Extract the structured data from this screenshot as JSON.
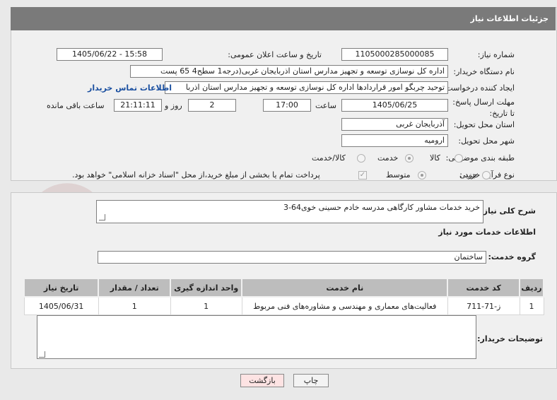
{
  "header": {
    "title": "جزئیات اطلاعات نیاز"
  },
  "watermark": {
    "text": "AriaTender.net"
  },
  "fields": {
    "need_number_label": "شماره نیاز:",
    "need_number": "1105000285000085",
    "announce_label": "تاریخ و ساعت اعلان عمومی:",
    "announce_value": "1405/06/22 - 15:58",
    "buyer_org_label": "نام دستگاه خریدار:",
    "buyer_org": "اداره کل نوسازی   توسعه و تجهیز مدارس استان اذربایجان غربی(درجه1  سطح4  65 پست",
    "creator_label": "ایجاد کننده درخواست:",
    "creator": "توحید چربگو امور قراردادها اداره کل نوسازی   توسعه و تجهیز مدارس استان اذربا",
    "buyer_contact_link": "اطلاعات تماس خریدار",
    "deadline_label": "مهلت ارسال پاسخ: تا تاریخ:",
    "deadline_date": "1405/06/25",
    "time_label": "ساعت",
    "deadline_time": "17:00",
    "days_value": "2",
    "days_label": "روز و",
    "remaining_time": "21:11:11",
    "remaining_label": "ساعت باقی مانده",
    "province_label": "استان محل تحویل:",
    "province": "آذربایجان غربی",
    "city_label": "شهر محل تحویل:",
    "city": "ارومیه",
    "category_label": "طبقه بندی موضوعی:",
    "category_options": [
      "کالا",
      "خدمت",
      "کالا/خدمت"
    ],
    "category_selected": "خدمت",
    "purchase_type_label": "نوع فرآیند خرید :",
    "purchase_options": [
      "جزیی",
      "متوسط"
    ],
    "purchase_selected": "متوسط",
    "payment_note": "پرداخت تمام یا بخشی از مبلغ خرید،از محل \"اسناد خزانه اسلامی\" خواهد بود."
  },
  "summary": {
    "label": "شرح کلی نیاز:",
    "value": "خرید خدمات مشاور کارگاهی مدرسه خادم حسینی خوی64-3",
    "services_heading": "اطلاعات خدمات مورد نیاز",
    "group_label": "گروه خدمت:",
    "group_value": "ساختمان"
  },
  "table": {
    "headers": [
      "ردیف",
      "کد خدمت",
      "نام خدمت",
      "واحد اندازه گیری",
      "تعداد / مقدار",
      "تاریخ نیاز"
    ],
    "rows": [
      [
        "1",
        "ز-71-711",
        "فعالیت‌های معماری و مهندسی و مشاوره‌های فنی مربوط",
        "1",
        "1",
        "1405/06/31"
      ]
    ]
  },
  "notes": {
    "label": "توضیحات خریدار:",
    "value": ""
  },
  "buttons": {
    "print": "چاپ",
    "back": "بازگشت"
  }
}
